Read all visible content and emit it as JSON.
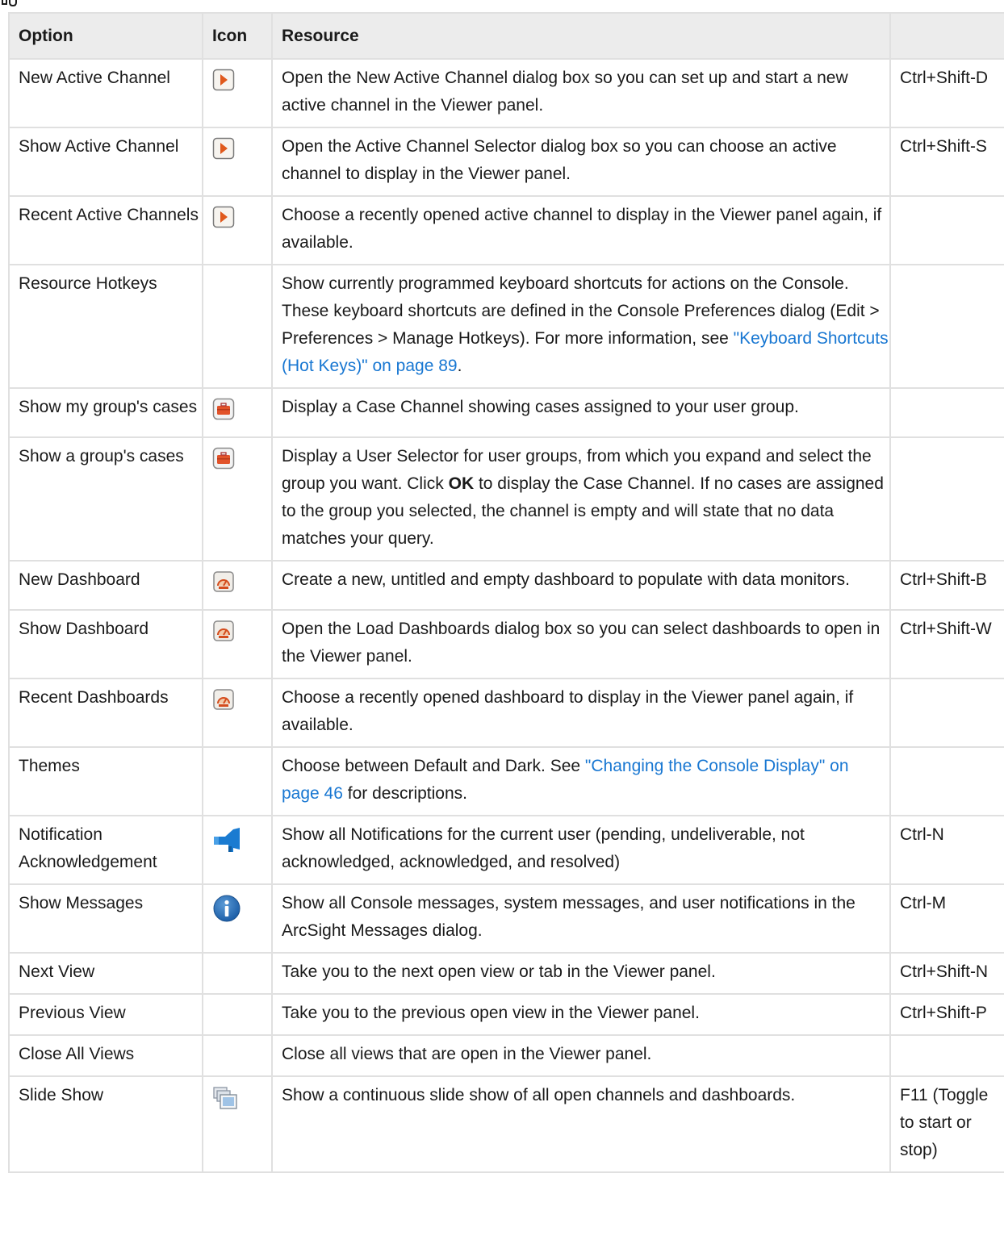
{
  "headers": {
    "option": "Option",
    "icon": "Icon",
    "resource": "Resource",
    "hotkey": ""
  },
  "rows": [
    {
      "option": "New Active Channel",
      "icon": "active-channel-icon",
      "resource": "Open the New Active Channel dialog box so you can set up and start a new active channel in the Viewer panel.",
      "hotkey": "Ctrl+Shift-D"
    },
    {
      "option": "Show Active Channel",
      "icon": "active-channel-icon",
      "resource": "Open the Active Channel Selector dialog box so you can choose an active channel to display in the Viewer panel.",
      "hotkey": "Ctrl+Shift-S"
    },
    {
      "option": "Recent Active Channels",
      "icon": "active-channel-icon",
      "resource": "Choose a recently opened active channel to display in the Viewer panel again, if available.",
      "hotkey": ""
    },
    {
      "option": "Resource Hotkeys",
      "icon": "",
      "resource_pre": "Show currently programmed keyboard shortcuts for actions on the Console. These keyboard shortcuts are defined in the Console Preferences dialog (Edit > Preferences > Manage Hotkeys). For more information, see ",
      "resource_link": "\"Keyboard Shortcuts (Hot Keys)\" on page 89",
      "resource_post": ".",
      "hotkey": ""
    },
    {
      "option": "Show my group's cases",
      "icon": "case-briefcase-icon",
      "resource": "Display a Case Channel showing cases assigned to your user group.",
      "hotkey": ""
    },
    {
      "option": "Show a group's cases",
      "icon": "case-briefcase-icon",
      "resource_pre": "Display a User Selector for user groups, from which you expand and select the group you want. Click ",
      "resource_bold": "OK",
      "resource_post": " to display the Case Channel. If no cases are assigned to the group you selected, the channel is empty and will state that no data matches your query.",
      "hotkey": ""
    },
    {
      "option": "New Dashboard",
      "icon": "dashboard-icon",
      "resource": "Create a new, untitled and empty dashboard to populate with data monitors.",
      "hotkey": "Ctrl+Shift-B"
    },
    {
      "option": "Show Dashboard",
      "icon": "dashboard-icon",
      "resource": "Open the Load Dashboards dialog box so you can select dashboards to open in the Viewer panel.",
      "hotkey": "Ctrl+Shift-W"
    },
    {
      "option": "Recent Dashboards",
      "icon": "dashboard-icon",
      "resource": "Choose a recently opened dashboard to display in the Viewer panel again, if available.",
      "hotkey": ""
    },
    {
      "option": "Themes",
      "icon": "",
      "resource_pre": "Choose between Default and Dark. See ",
      "resource_link": "\"Changing the Console Display\" on page 46",
      "resource_post": " for descriptions.",
      "hotkey": ""
    },
    {
      "option": "Notification Acknowledgement",
      "icon": "notification-icon",
      "resource": "Show all Notifications for the current user (pending, undeliverable, not acknowledged, acknowledged, and resolved)",
      "hotkey": "Ctrl-N"
    },
    {
      "option": "Show Messages",
      "icon": "info-icon",
      "resource": "Show all Console messages, system messages, and user notifications in the ArcSight Messages dialog.",
      "hotkey": "Ctrl-M"
    },
    {
      "option": "Next View",
      "icon": "",
      "resource": "Take you to the next open view or tab in the Viewer panel.",
      "hotkey": "Ctrl+Shift-N"
    },
    {
      "option": "Previous View",
      "icon": "",
      "resource": "Take you to the previous open view in the Viewer panel.",
      "hotkey": "Ctrl+Shift-P"
    },
    {
      "option": "Close All Views",
      "icon": "",
      "resource": "Close all views that are open in the Viewer panel.",
      "hotkey": ""
    },
    {
      "option": "Slide Show",
      "icon": "slide-show-icon",
      "resource": "Show a continuous slide show of all open channels and dashboards.",
      "hotkey": "F11 (Toggle to start or stop)"
    }
  ]
}
